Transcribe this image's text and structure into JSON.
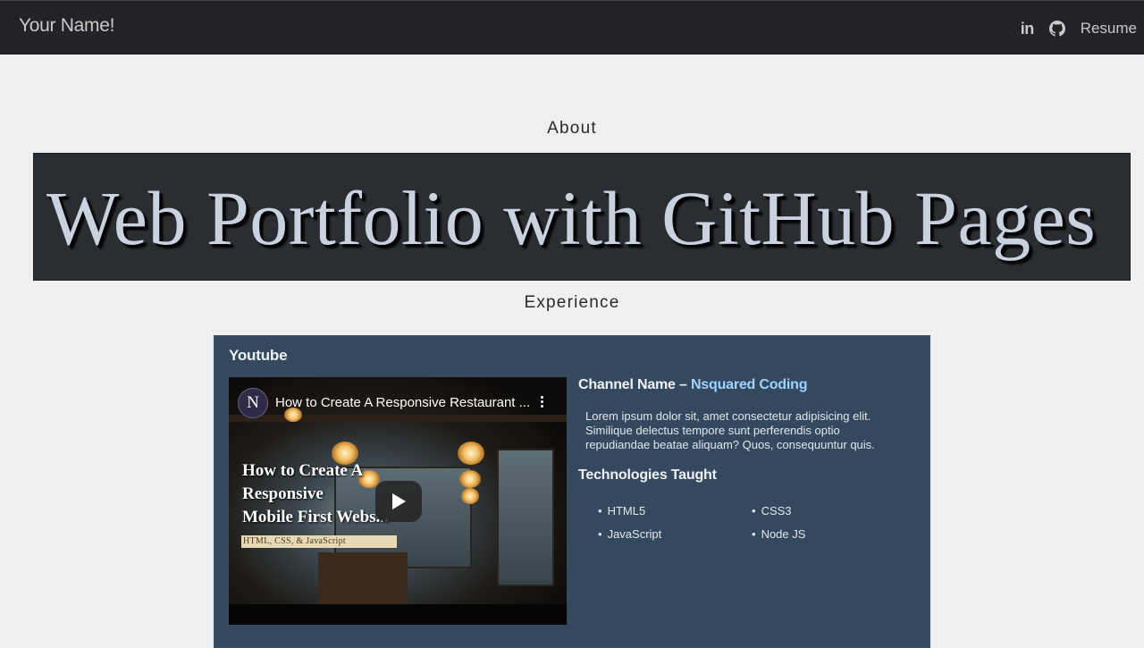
{
  "nav": {
    "brand": "Your Name!",
    "icons": [
      "linkedin-icon",
      "github-icon"
    ],
    "linkedin_text": "in",
    "resume_label": "Resume"
  },
  "about": {
    "title": "About",
    "banner_text": "Web Portfolio with GitHub Pages"
  },
  "experience": {
    "title": "Experience",
    "card": {
      "title": "Youtube",
      "video": {
        "channel_logo_text": "N",
        "title": "How to Create A Responsive Restaurant ...",
        "thumbnail_title_lines": [
          "How to Create A",
          "Responsive",
          "Mobile First Webs..."
        ],
        "thumbnail_tag": "HTML, CSS, & JavaScript",
        "play_icon": "play-icon",
        "menu_icon": "kebab-menu-icon"
      },
      "channel_label": "Channel Name – ",
      "channel_name": "Nsquared Coding",
      "description": "Lorem ipsum dolor sit, amet consectetur adipisicing elit. Similique delectus tempore sunt perferendis optio repudiandae beatae aliquam? Quos, consequuntur quis.",
      "technologies_title": "Technologies Taught",
      "technologies": [
        "HTML5",
        "CSS3",
        "JavaScript",
        "Node JS"
      ]
    }
  },
  "colors": {
    "navbar_bg": "#212326",
    "page_bg": "#f0f0f0",
    "banner_bg": "#2a2d31",
    "card_bg": "#34495e",
    "link": "#9fd2ff"
  }
}
